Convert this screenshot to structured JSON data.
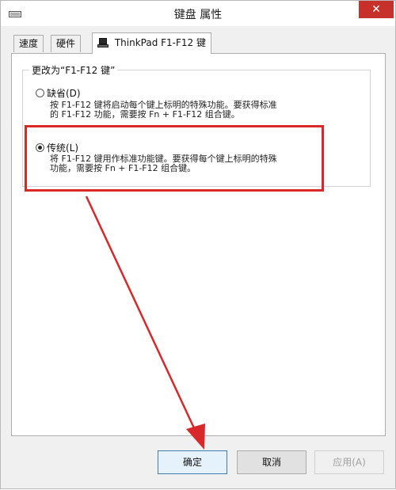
{
  "window": {
    "title": "键盘 属性",
    "close_label": "✕"
  },
  "tabs": [
    {
      "label": "速度"
    },
    {
      "label": "硬件"
    },
    {
      "label": "ThinkPad F1-F12 键"
    }
  ],
  "group": {
    "legend": "更改为“F1-F12 键”",
    "options": [
      {
        "label": "缺省(D)",
        "checked": false,
        "desc1": "按 F1-F12 键将启动每个键上标明的特殊功能。要获得标准",
        "desc2": "的 F1-F12 功能，需要按 Fn + F1-F12 组合键。"
      },
      {
        "label": "传统(L)",
        "checked": true,
        "desc1": "将 F1-F12 键用作标准功能键。要获得每个键上标明的特殊",
        "desc2": "功能，需要按 Fn + F1-F12 组合键。"
      }
    ]
  },
  "buttons": {
    "ok": "确定",
    "cancel": "取消",
    "apply": "应用(A)"
  },
  "colors": {
    "highlight": "#d9282a",
    "close_bg": "#c7302b"
  }
}
